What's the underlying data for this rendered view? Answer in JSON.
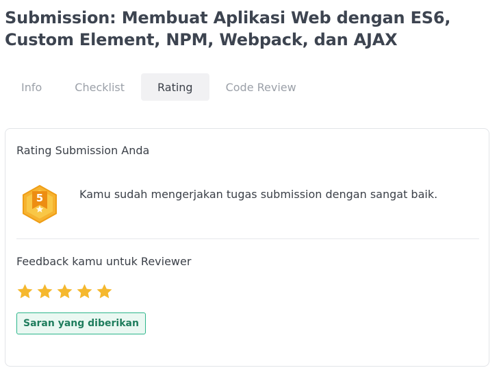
{
  "page": {
    "title": "Submission: Membuat Aplikasi Web dengan ES6, Custom Element, NPM, Webpack, dan AJAX"
  },
  "tabs": [
    {
      "label": "Info",
      "active": false
    },
    {
      "label": "Checklist",
      "active": false
    },
    {
      "label": "Rating",
      "active": true
    },
    {
      "label": "Code Review",
      "active": false
    }
  ],
  "rating": {
    "heading": "Rating Submission Anda",
    "score": "5",
    "message": "Kamu sudah mengerjakan tugas submission dengan sangat baik."
  },
  "feedback": {
    "heading": "Feedback kamu untuk Reviewer",
    "stars": 5,
    "max_stars": 5,
    "suggestion_badge": "Saran yang diberikan"
  },
  "colors": {
    "star": "#f5b82e",
    "badge_gold": "#f2a81d",
    "suggestion_green": "#2bb58a"
  }
}
